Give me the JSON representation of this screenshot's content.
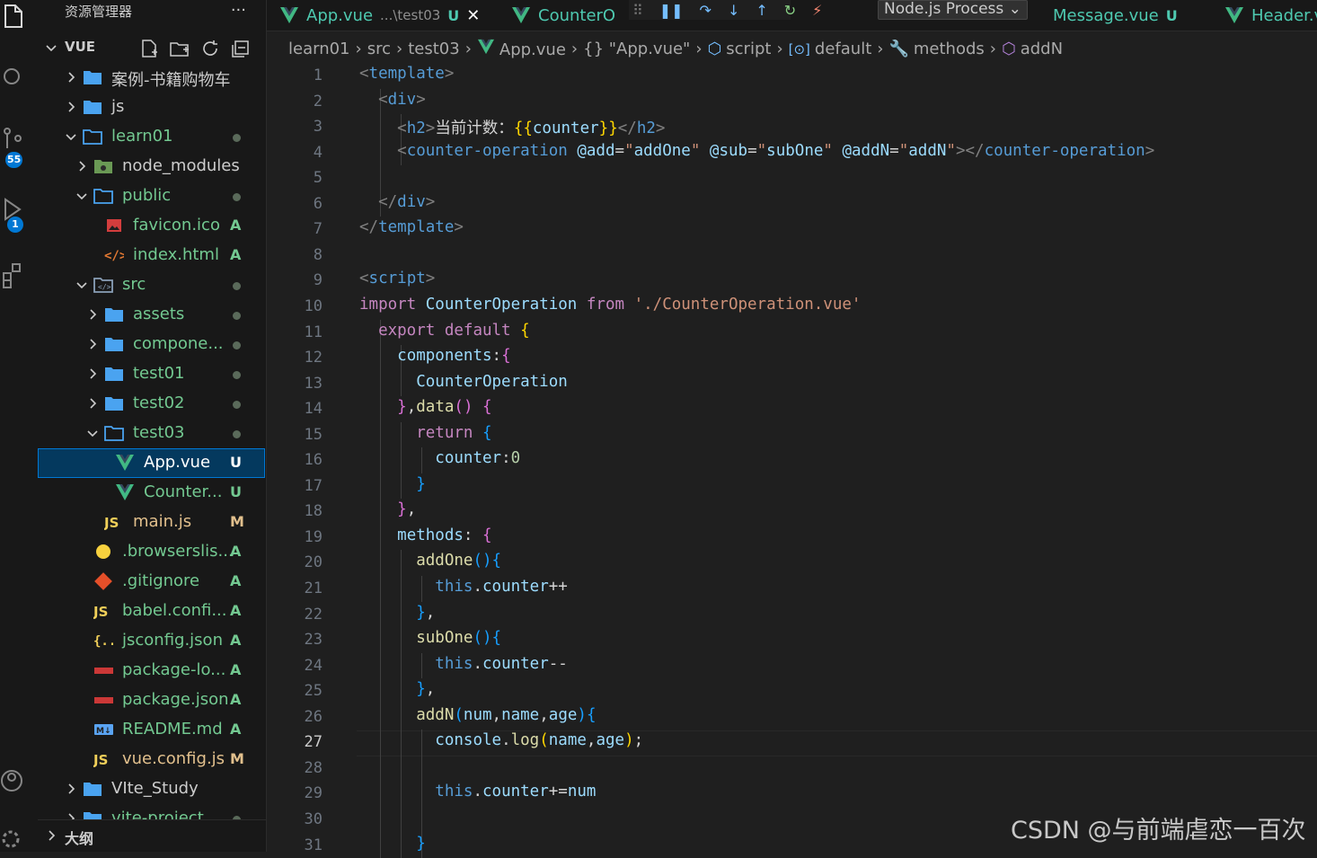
{
  "explorer": {
    "title": "资源管理器",
    "more": "···",
    "workspace": "VUE",
    "tree": [
      {
        "label": "案例-书籍购物车",
        "kind": "folder",
        "depth": 0,
        "expanded": false,
        "status": ""
      },
      {
        "label": "js",
        "kind": "folder",
        "depth": 0,
        "expanded": false,
        "status": ""
      },
      {
        "label": "learn01",
        "kind": "folder",
        "depth": 0,
        "expanded": true,
        "status": "dot"
      },
      {
        "label": "node_modules",
        "kind": "node",
        "depth": 1,
        "expanded": false,
        "status": ""
      },
      {
        "label": "public",
        "kind": "folder",
        "depth": 1,
        "expanded": true,
        "status": "dot"
      },
      {
        "label": "favicon.ico",
        "kind": "image",
        "depth": 2,
        "status": "A"
      },
      {
        "label": "index.html",
        "kind": "html",
        "depth": 2,
        "status": "A"
      },
      {
        "label": "src",
        "kind": "src",
        "depth": 1,
        "expanded": true,
        "status": "dot"
      },
      {
        "label": "assets",
        "kind": "folder",
        "depth": 2,
        "expanded": false,
        "status": "dot"
      },
      {
        "label": "compone...",
        "kind": "folder",
        "depth": 2,
        "expanded": false,
        "status": "dot"
      },
      {
        "label": "test01",
        "kind": "folder",
        "depth": 2,
        "expanded": false,
        "status": "dot"
      },
      {
        "label": "test02",
        "kind": "folder",
        "depth": 2,
        "expanded": false,
        "status": "dot"
      },
      {
        "label": "test03",
        "kind": "folder",
        "depth": 2,
        "expanded": true,
        "status": "dot"
      },
      {
        "label": "App.vue",
        "kind": "vue",
        "depth": 3,
        "status": "U",
        "selected": true
      },
      {
        "label": "Counter...",
        "kind": "vue",
        "depth": 3,
        "status": "U"
      },
      {
        "label": "main.js",
        "kind": "js",
        "depth": 2,
        "status": "M"
      },
      {
        "label": ".browserslis...",
        "kind": "browsers",
        "depth": 1,
        "status": "A"
      },
      {
        "label": ".gitignore",
        "kind": "git",
        "depth": 1,
        "status": "A"
      },
      {
        "label": "babel.confi...",
        "kind": "js",
        "depth": 1,
        "status": "A"
      },
      {
        "label": "jsconfig.json",
        "kind": "json",
        "depth": 1,
        "status": "A"
      },
      {
        "label": "package-lo...",
        "kind": "npm",
        "depth": 1,
        "status": "A"
      },
      {
        "label": "package.json",
        "kind": "npm",
        "depth": 1,
        "status": "A"
      },
      {
        "label": "README.md",
        "kind": "md",
        "depth": 1,
        "status": "A"
      },
      {
        "label": "vue.config.js",
        "kind": "js",
        "depth": 1,
        "status": "M"
      },
      {
        "label": "VIte_Study",
        "kind": "folder",
        "depth": 0,
        "expanded": false,
        "status": ""
      },
      {
        "label": "vite-project",
        "kind": "folder",
        "depth": 0,
        "expanded": false,
        "status": "dot"
      }
    ],
    "outline": "大纲"
  },
  "activity_badges": {
    "source_control": "55",
    "run_debug": "1"
  },
  "tabs": [
    {
      "label": "App.vue",
      "sub": "...\\test03",
      "status": "U",
      "close": "✕"
    },
    {
      "label": "CounterO",
      "sub": "",
      "status": ""
    },
    {
      "label": "Message.vue",
      "sub": "",
      "status": "U"
    },
    {
      "label": "Header.v",
      "sub": "",
      "status": ""
    }
  ],
  "debug_toolbar": {
    "process": "Node.js Process"
  },
  "breadcrumbs": [
    "learn01",
    "src",
    "test03",
    "App.vue",
    "{} \"App.vue\"",
    "script",
    "default",
    "methods",
    "addN"
  ],
  "current_line": 27,
  "line_numbers": [
    "1",
    "2",
    "3",
    "4",
    "5",
    "6",
    "7",
    "8",
    "9",
    "10",
    "11",
    "12",
    "13",
    "14",
    "15",
    "16",
    "17",
    "18",
    "19",
    "20",
    "21",
    "22",
    "23",
    "24",
    "25",
    "26",
    "27",
    "28",
    "29",
    "30",
    "31"
  ],
  "watermark": "CSDN @与前端虐恋一百次"
}
